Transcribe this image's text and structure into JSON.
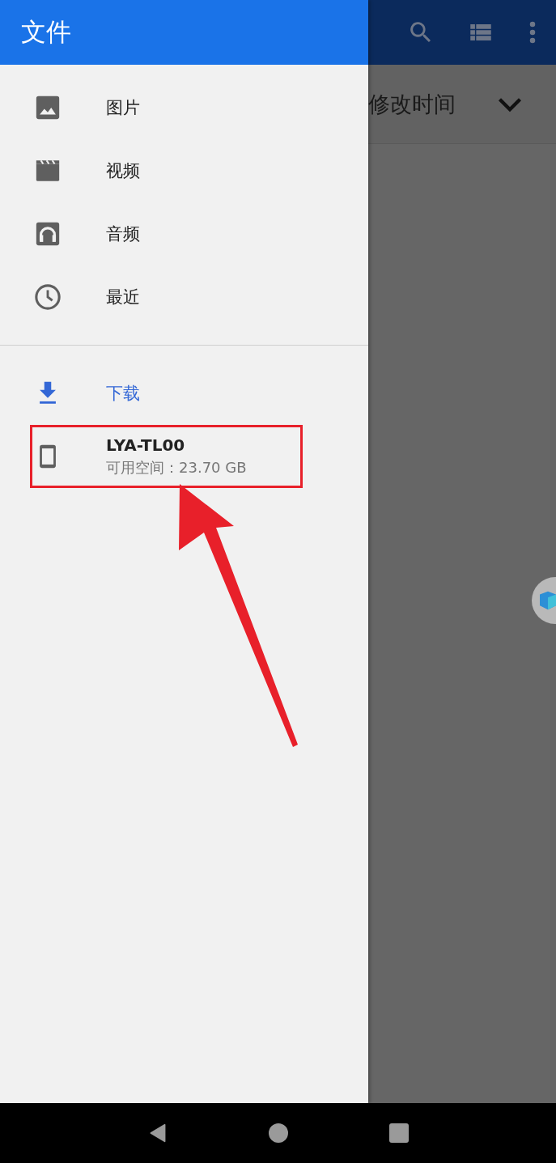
{
  "app_bar": {
    "sort_label": "修改时间"
  },
  "drawer": {
    "title": "文件",
    "sections": [
      {
        "items": [
          {
            "kind": "images",
            "label": "图片",
            "selected": false,
            "highlighted": false
          },
          {
            "kind": "videos",
            "label": "视频",
            "selected": false,
            "highlighted": false
          },
          {
            "kind": "audio",
            "label": "音频",
            "selected": false,
            "highlighted": false
          },
          {
            "kind": "recent",
            "label": "最近",
            "selected": false,
            "highlighted": false
          }
        ]
      },
      {
        "items": [
          {
            "kind": "downloads",
            "label": "下载",
            "selected": true,
            "highlighted": false
          },
          {
            "kind": "device",
            "label": "LYA-TL00",
            "subtitle": "可用空间：23.70 GB",
            "selected": false,
            "highlighted": true
          }
        ]
      }
    ]
  },
  "pointer_arrow": true
}
